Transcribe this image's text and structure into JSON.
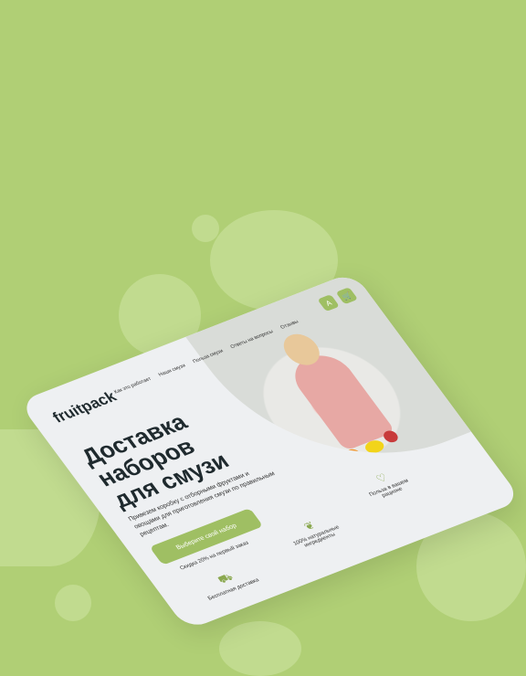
{
  "brand": "fruitpack",
  "nav": [
    "Как это работает",
    "Наши смузи",
    "Польза смузи",
    "Ответы на вопросы",
    "Отзывы"
  ],
  "hero": {
    "title": "Доставка наборов для смузи",
    "subtitle": "Привезем коробку с отборными фруктами и овощами для приготовления смузи по правильным рецептам.",
    "cta": "Выберите свой набор",
    "discount": "Скидка 20% на первый заказ"
  },
  "features": [
    {
      "icon": "truck-icon",
      "label": "Бесплатная доставка"
    },
    {
      "icon": "fruit-icon",
      "label": "100% натуральные ингредиенты"
    },
    {
      "icon": "heart-icon",
      "label": "Польза в вашем рационе"
    }
  ],
  "header_icons": {
    "account": "A",
    "cart": "🛒"
  }
}
